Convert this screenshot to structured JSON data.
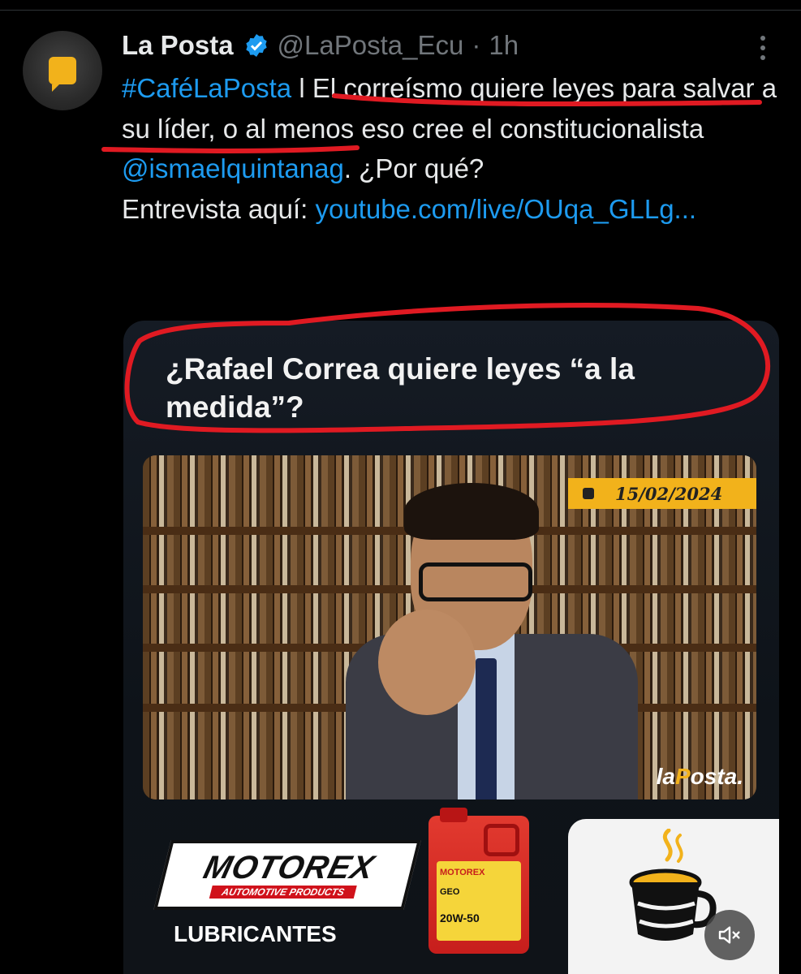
{
  "tweet": {
    "author_name": "La Posta",
    "handle": "@LaPosta_Ecu",
    "separator": "·",
    "time": "1h",
    "hashtag": "#CaféLaPosta",
    "text_1": " l El correísmo quiere leyes para salvar a su líder, o al menos eso cree el constitucionalista ",
    "mention": "@ismaelquintanag",
    "text_2": ". ¿Por qué?",
    "interview_label": "Entrevista aquí: ",
    "url": "youtube.com/live/OUqa_GLLg..."
  },
  "media": {
    "headline": "¿Rafael Correa quiere leyes “a la medida”?",
    "date": "15/02/2024",
    "watermark": "laPosta.",
    "sponsor_brand": "MOTOREX",
    "sponsor_sub": "AUTOMOTIVE PRODUCTS",
    "sponsor_caption": "LUBRICANTES",
    "oil_brand": "MOTOREX",
    "oil_line": "GEO",
    "oil_viscosity": "20W-50"
  },
  "icons": {
    "verified": "verified-badge-icon",
    "more": "more-options-icon",
    "mute": "volume-muted-icon",
    "coffee": "coffee-cup-icon"
  },
  "colors": {
    "background": "#000000",
    "text": "#e7e9ea",
    "secondary_text": "#71767b",
    "link": "#1d9bf0",
    "accent_yellow": "#f2b21b",
    "annotation_red": "#e01a22"
  }
}
